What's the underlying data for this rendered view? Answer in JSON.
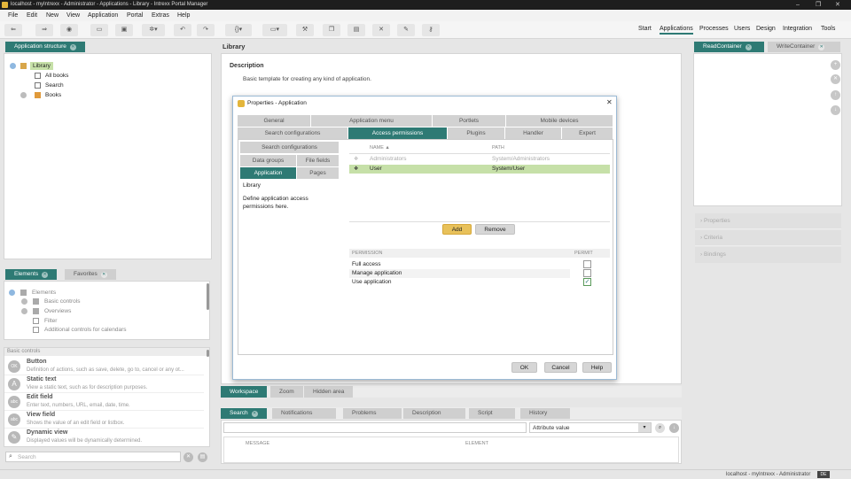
{
  "window": {
    "title": "localhost - myIntrexx - Administrator - Applications - Library - Intrexx Portal Manager",
    "controls": [
      "–",
      "❐",
      "✕"
    ]
  },
  "menu": [
    "File",
    "Edit",
    "New",
    "View",
    "Application",
    "Portal",
    "Extras",
    "Help"
  ],
  "nav": {
    "items": [
      "Start",
      "Applications",
      "Processes",
      "Users",
      "Design",
      "Integration",
      "Tools"
    ],
    "active": "Applications"
  },
  "structure_panel": {
    "tab": "Application structure",
    "root": "Library",
    "items": [
      "All books",
      "Search",
      "Books"
    ]
  },
  "elements_panel": {
    "tabs": [
      "Elements",
      "Favorites"
    ],
    "tree_root": "Elements",
    "tree_items": [
      "Basic controls",
      "Overviews",
      "Filter",
      "Additional controls for calendars"
    ],
    "section_header": "Basic controls",
    "controls": [
      {
        "title": "Button",
        "desc": "Definition of actions, such as save, delete, go to, cancel or any ot...",
        "icon": "button-icon",
        "glyph": "OK"
      },
      {
        "title": "Static text",
        "desc": "View a static text, such as for description purposes.",
        "icon": "static-text-icon",
        "glyph": "A"
      },
      {
        "title": "Edit field",
        "desc": "Enter text, numbers, URL, email, date, time.",
        "icon": "edit-field-icon",
        "glyph": "abc"
      },
      {
        "title": "View field",
        "desc": "Shows the value of an edit field or listbox.",
        "icon": "view-field-icon",
        "glyph": "abc"
      },
      {
        "title": "Dynamic view",
        "desc": "Displayed values will be dynamically determined.",
        "icon": "dynamic-view-icon",
        "glyph": "✎"
      }
    ],
    "search_placeholder": "Search"
  },
  "main": {
    "title": "Library",
    "description_heading": "Description",
    "description_text": "Basic template for creating any kind of application.",
    "bottom_tabs": [
      "Workspace",
      "Zoom",
      "Hidden area"
    ],
    "log_tabs": [
      "Search",
      "Notifications",
      "Problems",
      "Description",
      "Script",
      "History"
    ],
    "attribute_select": "Attribute value",
    "log_columns": [
      "MESSAGE",
      "ELEMENT"
    ]
  },
  "right_panel": {
    "tabs": [
      "ReadContainer",
      "WriteContainer"
    ],
    "sections": [
      "Properties",
      "Criteria",
      "Bindings"
    ]
  },
  "status": {
    "text": "localhost - myIntrexx - Administrator",
    "badge": "DE"
  },
  "dialog": {
    "title": "Properties - Application",
    "tabs_row1": [
      "General",
      "Application menu",
      "Portlets",
      "Mobile devices"
    ],
    "tabs_row2": [
      "Search configurations",
      "Access permissions",
      "Plugins",
      "Handler",
      "Expert"
    ],
    "active_tab": "Access permissions",
    "left_tabs": [
      "Search configurations",
      "Data groups",
      "File fields",
      "Application",
      "Pages"
    ],
    "left_active": "Application",
    "left_title": "Library",
    "left_text": "Define application access permissions here.",
    "table_headers": {
      "name": "NAME ▲",
      "path": "PATH"
    },
    "rows": [
      {
        "name": "Administrators",
        "path": "System/Administrators",
        "selected": false
      },
      {
        "name": "User",
        "path": "System/User",
        "selected": true
      }
    ],
    "add_label": "Add",
    "remove_label": "Remove",
    "perm_headers": {
      "permission": "PERMISSION",
      "permit": "PERMIT"
    },
    "permissions": [
      {
        "label": "Full access",
        "checked": false
      },
      {
        "label": "Manage application",
        "checked": false
      },
      {
        "label": "Use application",
        "checked": true
      }
    ],
    "ok_label": "OK",
    "cancel_label": "Cancel",
    "help_label": "Help"
  },
  "colors": {
    "accent": "#2e7a74",
    "selected_row": "#c6e0a8",
    "add_button": "#e8c15a"
  }
}
